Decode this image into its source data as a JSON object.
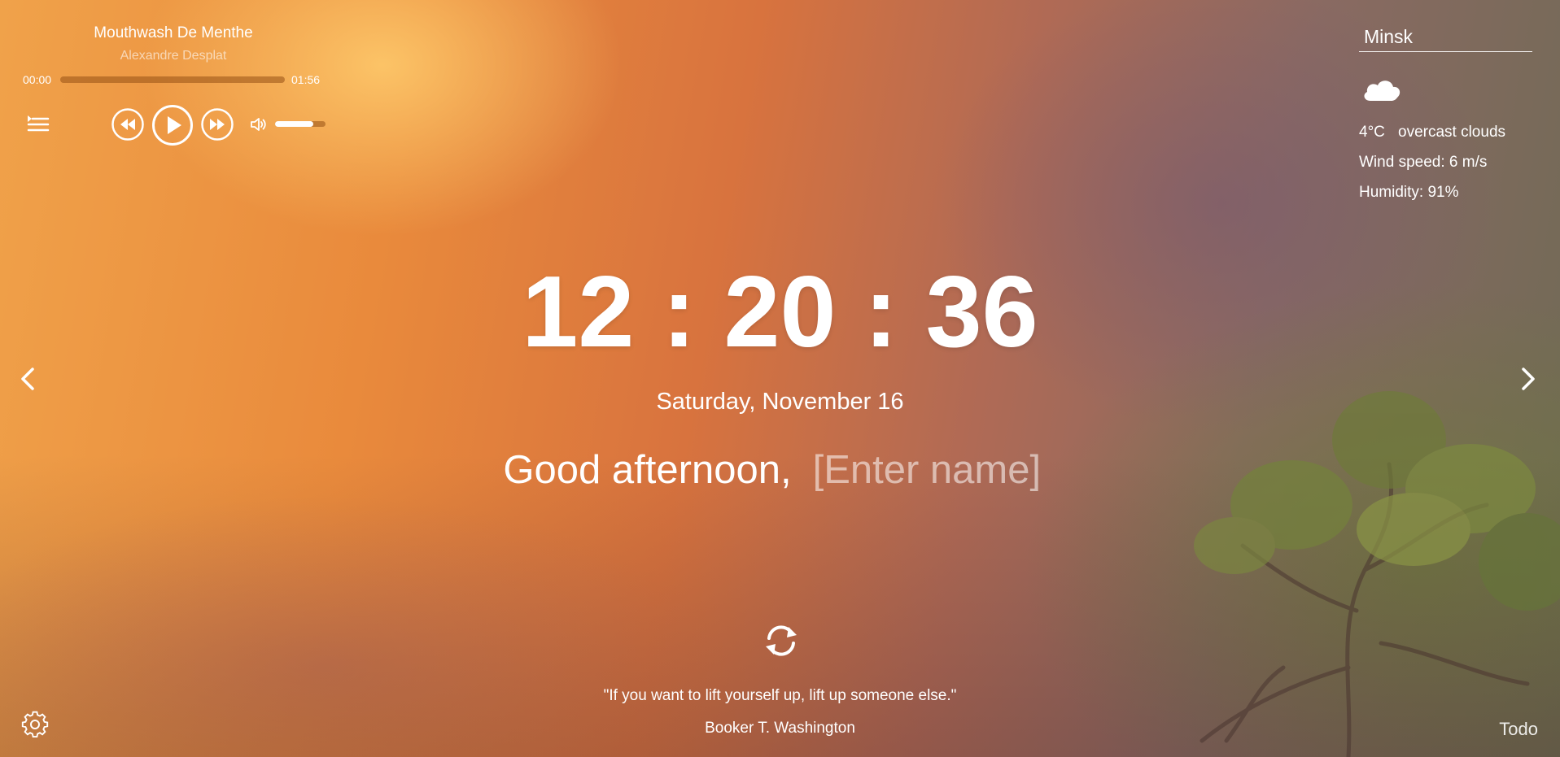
{
  "player": {
    "track_title": "Mouthwash De Menthe",
    "track_artist": "Alexandre Desplat",
    "current_time": "00:00",
    "total_time": "01:56",
    "progress": 0,
    "volume": 0.75,
    "icons": {
      "playlist": "playlist-icon",
      "rewind": "rewind-icon",
      "play": "play-icon",
      "forward": "fast-forward-icon",
      "volume": "volume-icon"
    }
  },
  "weather": {
    "city": "Minsk",
    "icon": "cloud-icon",
    "temperature": "4°C",
    "description": "overcast clouds",
    "wind": "Wind speed: 6 m/s",
    "humidity": "Humidity: 91%"
  },
  "clock": {
    "time": "12 : 20 : 36"
  },
  "date": "Saturday, November 16",
  "greeting": {
    "text": "Good afternoon,",
    "name_placeholder": "[Enter name]",
    "name_value": ""
  },
  "navigation": {
    "prev_icon": "chevron-left-icon",
    "next_icon": "chevron-right-icon"
  },
  "quote": {
    "refresh_icon": "refresh-icon",
    "text": "\"If you want to lift yourself up, lift up someone else.\"",
    "author": "Booker T. Washington"
  },
  "footer": {
    "settings_icon": "gear-icon",
    "todo_label": "Todo"
  },
  "colors": {
    "text": "#ffffff",
    "progress_track": "#965014",
    "accent_warm": "#f0a24a"
  }
}
